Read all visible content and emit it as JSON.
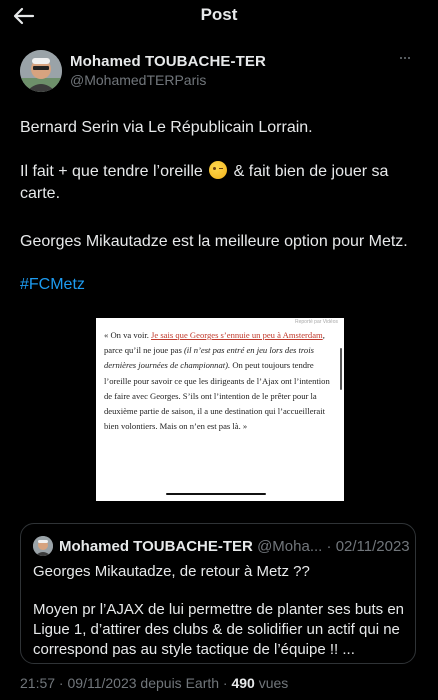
{
  "header": {
    "title": "Post",
    "back_icon": "arrow-left-icon"
  },
  "tweet": {
    "author_name": "Mohamed TOUBACHE-TER",
    "author_handle": "@MohamedTERParis",
    "more_icon": "more-horizontal-icon",
    "para1": "Bernard Serin via Le Républicain Lorrain.",
    "para2_before": "Il fait + que tendre l’oreille ",
    "para2_emoji": "winking-face-emoji",
    "para2_after": " & fait bien de jouer sa carte.",
    "para3": "Georges Mikautadze est la meilleure option pour Metz.",
    "hashtag": "#FCMetz"
  },
  "media": {
    "credit": "Reporté par Vidéos",
    "text_open": "« On va voir. ",
    "text_red": "Je sais que Georges s’ennuie un peu à Amsterdam",
    "text_mid": ", parce qu’il ne joue pas ",
    "text_italic": "(il n’est pas entré en jeu lors des trois dernières journées de championnat).",
    "text_rest": " On peut toujours tendre l’oreille pour savoir ce que les dirigeants de l’Ajax ont l’intention de faire avec Georges. S’ils ont l’intention de le prêter pour la deuxième partie de saison, il a une destination qui l’accueillerait bien volontiers. Mais on n’en est pas là. »"
  },
  "quote": {
    "author_name": "Mohamed TOUBACHE-TER",
    "author_handle": "@Moha...",
    "separator": "·",
    "date": "02/11/2023",
    "line1": "Georges Mikautadze, de retour à Metz ??",
    "line2": "Moyen pr l’AJAX de lui permettre de planter ses buts en Ligue 1, d’attirer des clubs & de solidifier un actif qui ne correspond pas au style tactique de l’équipe !! ..."
  },
  "footer": {
    "time": "21:57",
    "sep1": " · ",
    "date": "09/11/2023",
    "source": " depuis Earth",
    "sep2": " · ",
    "views_count": "490",
    "views_label": " vues"
  }
}
